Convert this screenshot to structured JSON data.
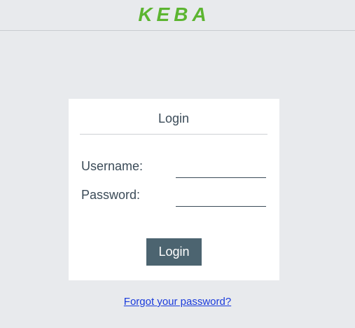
{
  "header": {
    "logo_text": "KEBA",
    "logo_color": "#5cb531"
  },
  "login_card": {
    "title": "Login",
    "username_label": "Username:",
    "username_value": "",
    "password_label": "Password:",
    "password_value": "",
    "login_button_label": "Login",
    "button_color": "#4c6470"
  },
  "footer": {
    "forgot_password_link": "Forgot your password?",
    "link_color": "#1a3bdc"
  }
}
